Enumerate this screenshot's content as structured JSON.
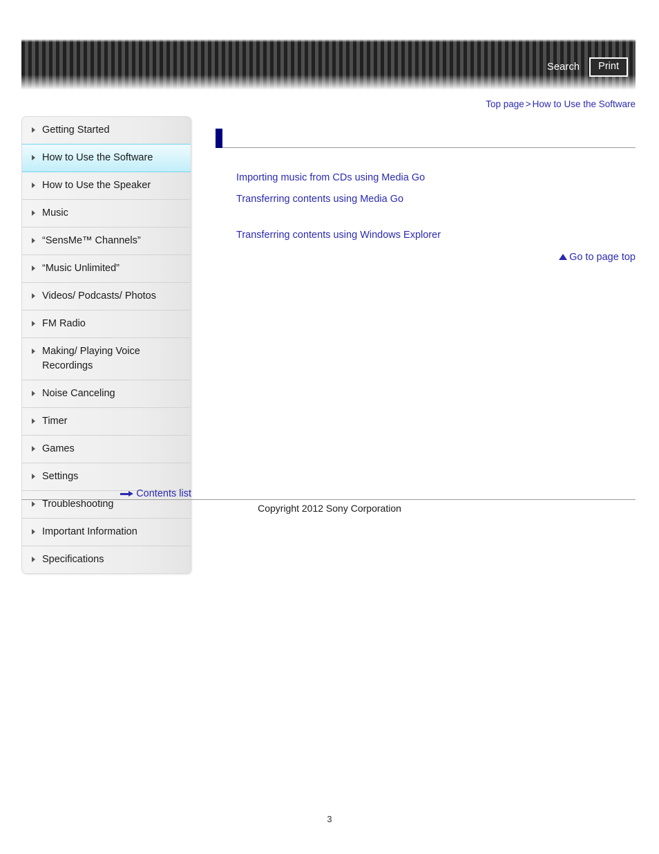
{
  "header": {
    "search_label": "Search",
    "print_label": "Print"
  },
  "breadcrumb": {
    "top_page": "Top page",
    "separator": ">",
    "current": "How to Use the Software"
  },
  "sidebar": {
    "items": [
      {
        "label": "Getting Started",
        "active": false
      },
      {
        "label": "How to Use the Software",
        "active": true
      },
      {
        "label": "How to Use the Speaker",
        "active": false
      },
      {
        "label": "Music",
        "active": false
      },
      {
        "label": "“SensMe™ Channels”",
        "active": false
      },
      {
        "label": "“Music Unlimited”",
        "active": false
      },
      {
        "label": "Videos/ Podcasts/ Photos",
        "active": false
      },
      {
        "label": "FM Radio",
        "active": false
      },
      {
        "label": "Making/ Playing Voice Recordings",
        "active": false
      },
      {
        "label": "Noise Canceling",
        "active": false
      },
      {
        "label": "Timer",
        "active": false
      },
      {
        "label": "Games",
        "active": false
      },
      {
        "label": "Settings",
        "active": false
      },
      {
        "label": "Troubleshooting",
        "active": false
      },
      {
        "label": "Important Information",
        "active": false
      },
      {
        "label": "Specifications",
        "active": false
      }
    ],
    "contents_list_label": "Contents list"
  },
  "main": {
    "section_heading": "",
    "links_group_1": [
      "Importing music from CDs using Media Go",
      "Transferring contents using Media Go"
    ],
    "links_group_2": [
      "Transferring contents using Windows Explorer"
    ],
    "go_to_page_top": "Go to page top"
  },
  "footer": {
    "copyright": "Copyright 2012 Sony Corporation",
    "page_number": "3"
  },
  "colors": {
    "link_blue": "#2a2ab0",
    "heading_bar_navy": "#00007e",
    "active_nav_cyan": "#72d5ef",
    "header_stripe_dark": "#212121",
    "header_stripe_light": "#4e4e4e"
  }
}
